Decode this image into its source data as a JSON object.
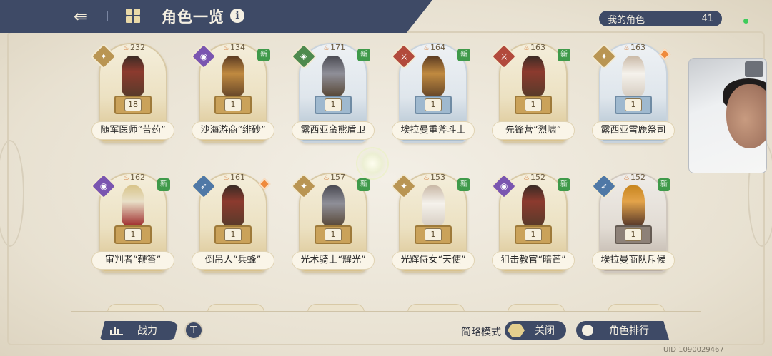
{
  "header": {
    "back_icon": "back-arrow-icon",
    "title": "角色一览",
    "info_icon": "info-icon"
  },
  "my_characters": {
    "label": "我的角色",
    "count": "41"
  },
  "cards": [
    {
      "name": "随军医师“苦药”",
      "power": "232",
      "level": "18",
      "class": "cls-gold",
      "class_symbol": "✦",
      "tint": "gold",
      "figure": "",
      "new": "",
      "marker": false
    },
    {
      "name": "沙海游商“绯砂”",
      "power": "134",
      "level": "1",
      "class": "cls-purple",
      "class_symbol": "◉",
      "tint": "gold",
      "figure": "tan",
      "new": "新",
      "marker": false
    },
    {
      "name": "露西亚蛮熊盾卫",
      "power": "171",
      "level": "1",
      "class": "cls-green",
      "class_symbol": "◈",
      "tint": "blue",
      "figure": "steel",
      "new": "新",
      "marker": false
    },
    {
      "name": "埃拉曼重斧斗士",
      "power": "164",
      "level": "1",
      "class": "cls-red",
      "class_symbol": "⚔",
      "tint": "blue",
      "figure": "tan",
      "new": "新",
      "marker": false
    },
    {
      "name": "先锋营“烈啸”",
      "power": "163",
      "level": "1",
      "class": "cls-red",
      "class_symbol": "⚔",
      "tint": "gold",
      "figure": "",
      "new": "新",
      "marker": false
    },
    {
      "name": "露西亚雪鹿祭司",
      "power": "163",
      "level": "1",
      "class": "cls-gold",
      "class_symbol": "✦",
      "tint": "blue",
      "figure": "white",
      "new": "",
      "marker": true
    },
    {
      "name": "审判者“鞭笞”",
      "power": "162",
      "level": "1",
      "class": "cls-purple",
      "class_symbol": "◉",
      "tint": "gold",
      "figure": "gold",
      "new": "新",
      "marker": false
    },
    {
      "name": "倒吊人“兵蜂”",
      "power": "161",
      "level": "1",
      "class": "cls-blue",
      "class_symbol": "➶",
      "tint": "gold",
      "figure": "",
      "new": "",
      "marker": true
    },
    {
      "name": "光术骑士“耀光”",
      "power": "157",
      "level": "1",
      "class": "cls-gold",
      "class_symbol": "✦",
      "tint": "gold",
      "figure": "steel",
      "new": "新",
      "marker": false
    },
    {
      "name": "光辉侍女“天使”",
      "power": "153",
      "level": "1",
      "class": "cls-gold",
      "class_symbol": "✦",
      "tint": "gold",
      "figure": "white",
      "new": "新",
      "marker": false
    },
    {
      "name": "狙击教官“暗芒”",
      "power": "152",
      "level": "1",
      "class": "cls-purple",
      "class_symbol": "◉",
      "tint": "gold",
      "figure": "",
      "new": "新",
      "marker": false
    },
    {
      "name": "埃拉曼商队斥候",
      "power": "152",
      "level": "1",
      "class": "cls-blue",
      "class_symbol": "➶",
      "tint": "gray",
      "figure": "orange",
      "new": "新",
      "marker": false
    }
  ],
  "bottom": {
    "power_button": "战力",
    "filter_icon": "filter-icon",
    "mode_label": "简略模式",
    "toggle_state": "关闭",
    "rank_button": "角色排行",
    "uid": "UID 1090029467"
  }
}
